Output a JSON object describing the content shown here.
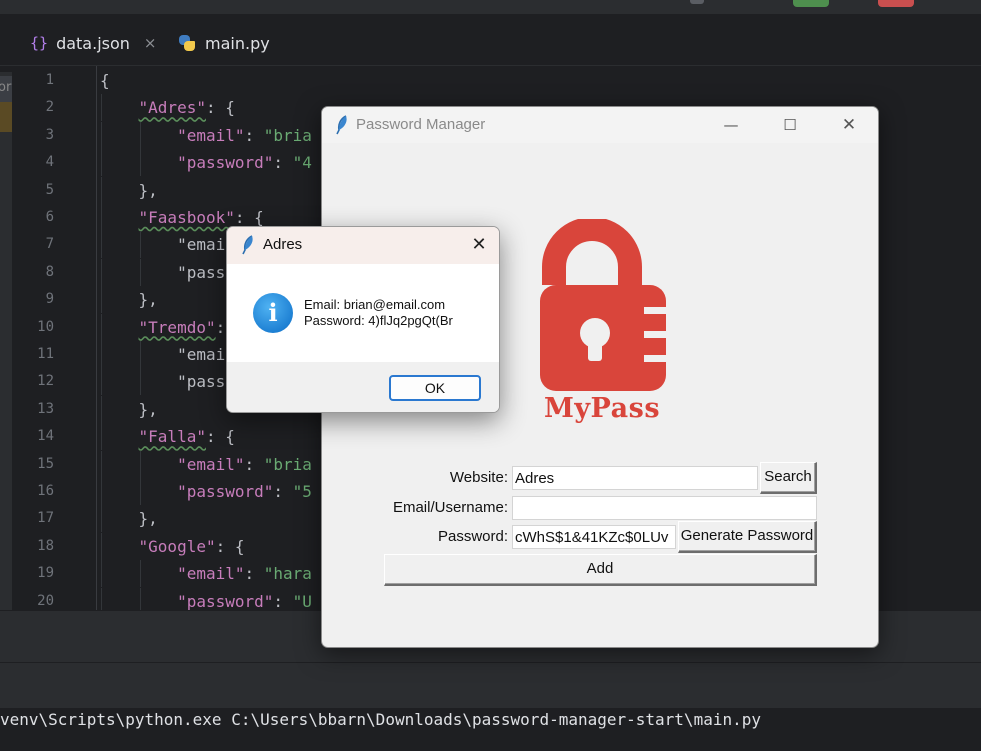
{
  "ide": {
    "tabs": [
      {
        "label": "data.json",
        "icon": "json-braces-icon",
        "close": "×"
      },
      {
        "label": "main.py",
        "icon": "python-icon"
      }
    ],
    "code_lines": [
      {
        "n": "1",
        "text": "{"
      },
      {
        "n": "2",
        "text": "    \"Adres\": {"
      },
      {
        "n": "3",
        "text": "        \"email\": \"bria"
      },
      {
        "n": "4",
        "text": "        \"password\": \"4"
      },
      {
        "n": "5",
        "text": "    },"
      },
      {
        "n": "6",
        "text": "    \"Faasbook\": {"
      },
      {
        "n": "7",
        "text": "        \"emai"
      },
      {
        "n": "8",
        "text": "        \"pass"
      },
      {
        "n": "9",
        "text": "    },"
      },
      {
        "n": "10",
        "text": "    \"Tremdo\":"
      },
      {
        "n": "11",
        "text": "        \"emai"
      },
      {
        "n": "12",
        "text": "        \"pass"
      },
      {
        "n": "13",
        "text": "    },"
      },
      {
        "n": "14",
        "text": "    \"Falla\": {"
      },
      {
        "n": "15",
        "text": "        \"email\": \"bria"
      },
      {
        "n": "16",
        "text": "        \"password\": \"5"
      },
      {
        "n": "17",
        "text": "    },"
      },
      {
        "n": "18",
        "text": "    \"Google\": {"
      },
      {
        "n": "19",
        "text": "        \"email\": \"hara"
      },
      {
        "n": "20",
        "text": "        \"password\": \"U"
      }
    ],
    "left_strip_text": "or",
    "terminal_text": "venv\\Scripts\\python.exe C:\\Users\\bbarn\\Downloads\\password-manager-start\\main.py"
  },
  "pm_window": {
    "title": "Password Manager",
    "logo_text": "MyPass",
    "website_label": "Website:",
    "website_value": "Adres",
    "search_label": "Search",
    "email_label": "Email/Username:",
    "email_value": "",
    "password_label": "Password:",
    "password_value": "cWhS$1&41KZc$0LUv",
    "generate_label": "Generate Password",
    "add_label": "Add",
    "min_glyph": "—",
    "max_glyph": "☐",
    "close_glyph": "✕"
  },
  "dialog": {
    "title": "Adres",
    "email_line": "Email: brian@email.com",
    "password_line": "Password: 4)flJq2pgQt(Br",
    "ok_label": "OK",
    "close_glyph": "✕",
    "icon_glyph": "i"
  },
  "colors": {
    "logo_red": "#d9453b",
    "json_key": "#c77dbb",
    "json_string": "#6aab73",
    "ok_border": "#2a78d0"
  }
}
